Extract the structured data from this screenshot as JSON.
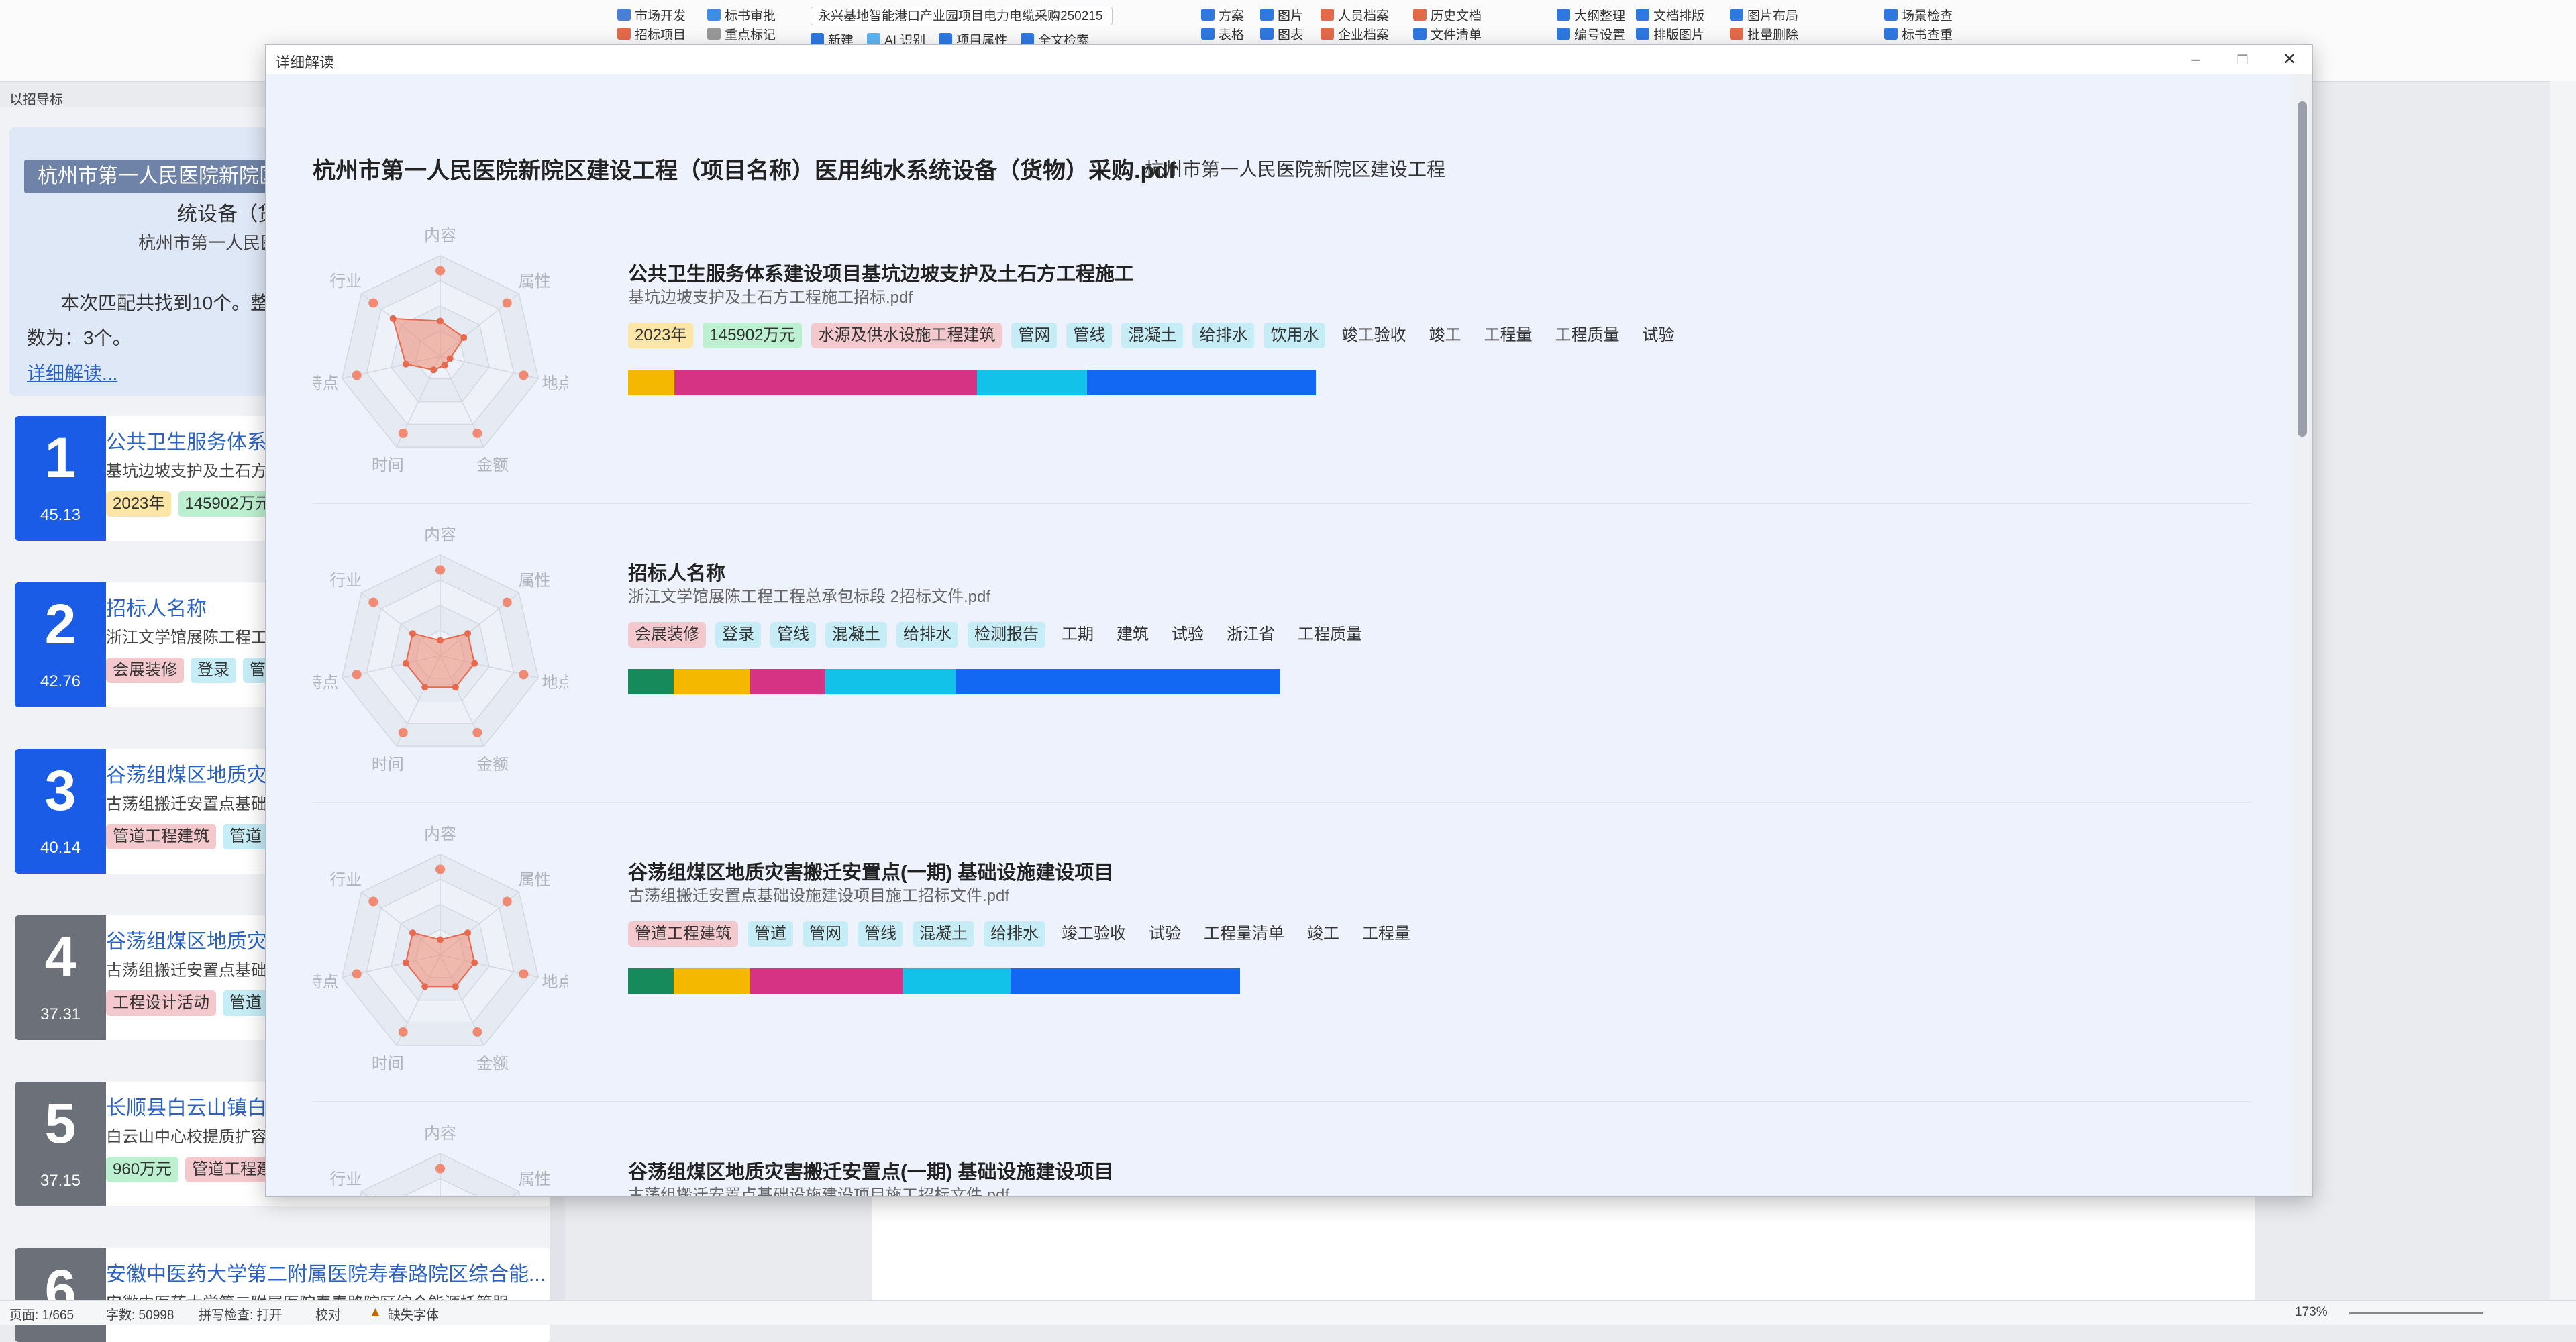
{
  "ribbon": {
    "groups": [
      {
        "items": [
          "市场开发",
          "招标项目"
        ]
      },
      {
        "items": [
          "标书审批",
          "重点标记"
        ]
      },
      {
        "items": [
          "新建",
          "AI 识别"
        ]
      },
      {
        "items": [
          "项目属性",
          "全文检索"
        ]
      },
      {
        "items": [
          "方案",
          "表格"
        ]
      },
      {
        "items": [
          "图片",
          "图表"
        ]
      },
      {
        "items": [
          "人员档案",
          "企业档案"
        ]
      },
      {
        "items": [
          "历史文档",
          "文件清单"
        ]
      },
      {
        "items": [
          "大纲整理",
          "编号设置"
        ]
      },
      {
        "items": [
          "文档排版",
          "排版图片"
        ]
      },
      {
        "items": [
          "图片布局",
          "批量删除"
        ]
      },
      {
        "items": [
          "场景检查",
          "标书查重"
        ]
      }
    ],
    "project_select": "永兴基地智能港口产业园项目电力电缆采购250215"
  },
  "left_nav_title": "以招导标",
  "summary": {
    "title": "杭州市第一人民医院新院区建设工程（项目名称）医用纯水系统设备（货物）采购",
    "title2": "统设备（货",
    "subtitle": "杭州市第一人民医",
    "text1": "本次匹配共找到10个。整",
    "text2": "数为：3个。",
    "link": "详细解读..."
  },
  "results": [
    {
      "rank": "1",
      "score": "45.13",
      "title": "公共卫生服务体系建",
      "desc": "基坑边坡支护及土石方",
      "tags": [
        {
          "text": "2023年",
          "cls": "t-yellow"
        },
        {
          "text": "145902万元",
          "cls": "t-green"
        }
      ],
      "color": "#1a5ce6"
    },
    {
      "rank": "2",
      "score": "42.76",
      "title": "招标人名称",
      "desc": "浙江文学馆展陈工程工",
      "tags": [
        {
          "text": "会展装修",
          "cls": "t-red"
        },
        {
          "text": "登录",
          "cls": "t-cyan"
        },
        {
          "text": "管",
          "cls": "t-cyan"
        }
      ],
      "color": "#1a5ce6"
    },
    {
      "rank": "3",
      "score": "40.14",
      "title": "谷荡组煤区地质灾害",
      "desc": "古荡组搬迁安置点基础",
      "tags": [
        {
          "text": "管道工程建筑",
          "cls": "t-red"
        },
        {
          "text": "管道",
          "cls": "t-cyan"
        }
      ],
      "color": "#1a5ce6"
    },
    {
      "rank": "4",
      "score": "37.31",
      "title": "谷荡组煤区地质灾害",
      "desc": "古荡组搬迁安置点基础",
      "tags": [
        {
          "text": "工程设计活动",
          "cls": "t-red"
        },
        {
          "text": "管道",
          "cls": "t-cyan"
        }
      ],
      "color": "#6b7079"
    },
    {
      "rank": "5",
      "score": "37.15",
      "title": "长顺县白云山镇白云",
      "desc": "白云山中心校提质扩容",
      "tags": [
        {
          "text": "960万元",
          "cls": "t-green"
        },
        {
          "text": "管道工程建",
          "cls": "t-red"
        }
      ],
      "color": "#6b7079"
    },
    {
      "rank": "6",
      "score": "",
      "title": "安徽中医药大学第二附属医院寿春路院区综合能...",
      "desc": "安徽中医药大学第二附属医院寿春路院区综合能源托管服",
      "tags": [],
      "color": "#6b7079"
    }
  ],
  "modal": {
    "window_title": "详细解读",
    "header_title": "杭州市第一人民医院新院区建设工程（项目名称）医用纯水系统设备（货物）采购.pdf",
    "header_sub": "杭州市第一人民医院新院区建设工程",
    "radar_axes": [
      "内容",
      "属性",
      "地点",
      "金额",
      "时间",
      "特点",
      "行业"
    ],
    "items": [
      {
        "title": "公共卫生服务体系建设项目基坑边坡支护及土石方工程施工",
        "file": "基坑边坡支护及土石方工程施工招标.pdf",
        "radar": [
          0.35,
          0.3,
          0.1,
          0.1,
          0.15,
          0.35,
          0.6
        ],
        "tags": [
          {
            "text": "2023年",
            "cls": "t-yellow"
          },
          {
            "text": "145902万元",
            "cls": "t-green"
          },
          {
            "text": "水源及供水设施工程建筑",
            "cls": "t-red"
          },
          {
            "text": "管网",
            "cls": "t-cyan"
          },
          {
            "text": "管线",
            "cls": "t-cyan"
          },
          {
            "text": "混凝土",
            "cls": "t-cyan"
          },
          {
            "text": "给排水",
            "cls": "t-cyan"
          },
          {
            "text": "饮用水",
            "cls": "t-cyan"
          },
          {
            "text": "竣工验收",
            "cls": "t-plain"
          },
          {
            "text": "竣工",
            "cls": "t-plain"
          },
          {
            "text": "工程量",
            "cls": "t-plain"
          },
          {
            "text": "工程质量",
            "cls": "t-plain"
          },
          {
            "text": "试验",
            "cls": "t-plain"
          }
        ],
        "bar": [
          {
            "color": "#f5b800",
            "width": 0.067
          },
          {
            "color": "#d63384",
            "width": 0.44
          },
          {
            "color": "#13c2e8",
            "width": 0.16
          },
          {
            "color": "#1268f3",
            "width": 0.333
          }
        ]
      },
      {
        "title": "招标人名称",
        "file": "浙江文学馆展陈工程工程总承包标段 2招标文件.pdf",
        "radar": [
          0.15,
          0.35,
          0.35,
          0.35,
          0.35,
          0.35,
          0.35
        ],
        "tags": [
          {
            "text": "会展装修",
            "cls": "t-red"
          },
          {
            "text": "登录",
            "cls": "t-cyan"
          },
          {
            "text": "管线",
            "cls": "t-cyan"
          },
          {
            "text": "混凝土",
            "cls": "t-cyan"
          },
          {
            "text": "给排水",
            "cls": "t-cyan"
          },
          {
            "text": "检测报告",
            "cls": "t-cyan"
          },
          {
            "text": "工期",
            "cls": "t-plain"
          },
          {
            "text": "建筑",
            "cls": "t-plain"
          },
          {
            "text": "试验",
            "cls": "t-plain"
          },
          {
            "text": "浙江省",
            "cls": "t-plain"
          },
          {
            "text": "工程质量",
            "cls": "t-plain"
          }
        ],
        "bar": [
          {
            "color": "#168a5a",
            "width": 0.07
          },
          {
            "color": "#f5b800",
            "width": 0.116
          },
          {
            "color": "#d63384",
            "width": 0.116
          },
          {
            "color": "#13c2e8",
            "width": 0.2
          },
          {
            "color": "#1268f3",
            "width": 0.498
          }
        ]
      },
      {
        "title": "谷荡组煤区地质灾害搬迁安置点(一期) 基础设施建设项目",
        "file": "古荡组搬迁安置点基础设施建设项目施工招标文件.pdf",
        "radar": [
          0.15,
          0.35,
          0.35,
          0.35,
          0.35,
          0.35,
          0.35
        ],
        "tags": [
          {
            "text": "管道工程建筑",
            "cls": "t-red"
          },
          {
            "text": "管道",
            "cls": "t-cyan"
          },
          {
            "text": "管网",
            "cls": "t-cyan"
          },
          {
            "text": "管线",
            "cls": "t-cyan"
          },
          {
            "text": "混凝土",
            "cls": "t-cyan"
          },
          {
            "text": "给排水",
            "cls": "t-cyan"
          },
          {
            "text": "竣工验收",
            "cls": "t-plain"
          },
          {
            "text": "试验",
            "cls": "t-plain"
          },
          {
            "text": "工程量清单",
            "cls": "t-plain"
          },
          {
            "text": "竣工",
            "cls": "t-plain"
          },
          {
            "text": "工程量",
            "cls": "t-plain"
          }
        ],
        "bar": [
          {
            "color": "#168a5a",
            "width": 0.075
          },
          {
            "color": "#f5b800",
            "width": 0.125
          },
          {
            "color": "#d63384",
            "width": 0.25
          },
          {
            "color": "#13c2e8",
            "width": 0.175
          },
          {
            "color": "#1268f3",
            "width": 0.375
          }
        ]
      },
      {
        "title": "谷荡组煤区地质灾害搬迁安置点(一期) 基础设施建设项目",
        "file": "古荡组搬迁安置点基础设施建设项目施工招标文件.pdf",
        "radar": [
          0.15,
          0.35,
          0.35,
          0.35,
          0.35,
          0.35,
          0.35
        ],
        "tags": [],
        "bar": []
      }
    ]
  },
  "statusbar": {
    "page": "页面: 1/665",
    "words": "字数: 50998",
    "spell": "拼写检查: 打开",
    "proof": "校对",
    "font": "缺失字体",
    "zoom": "173%"
  },
  "colors": {
    "accent": "#2b62c9",
    "radar_fill": "#f08a72",
    "radar_stroke": "#e86a4e"
  }
}
